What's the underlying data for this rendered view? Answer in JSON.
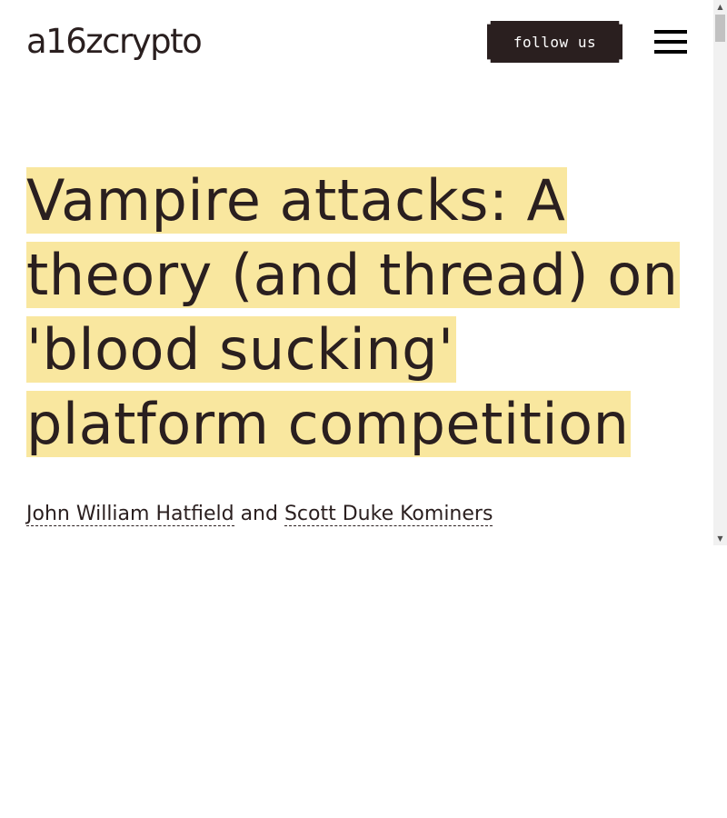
{
  "header": {
    "logo_text": "a16zcrypto",
    "follow_label": "follow us",
    "menu_icon": "hamburger-menu-icon"
  },
  "article": {
    "title_lines": [
      "Vampire attacks: A",
      "theory (and thread) on",
      "'blood sucking'",
      "platform competition"
    ],
    "byline": {
      "author_1": "John William Hatfield",
      "separator": "and",
      "author_2": "Scott Duke Kominers"
    }
  },
  "scrollbar": {
    "up_icon": "scroll-up-arrow-icon",
    "down_icon": "scroll-down-arrow-icon"
  },
  "colors": {
    "text": "#2a1f1f",
    "highlight": "#f9e79f",
    "button_bg": "#2a1f1f",
    "button_text": "#ffffff",
    "background": "#ffffff"
  }
}
